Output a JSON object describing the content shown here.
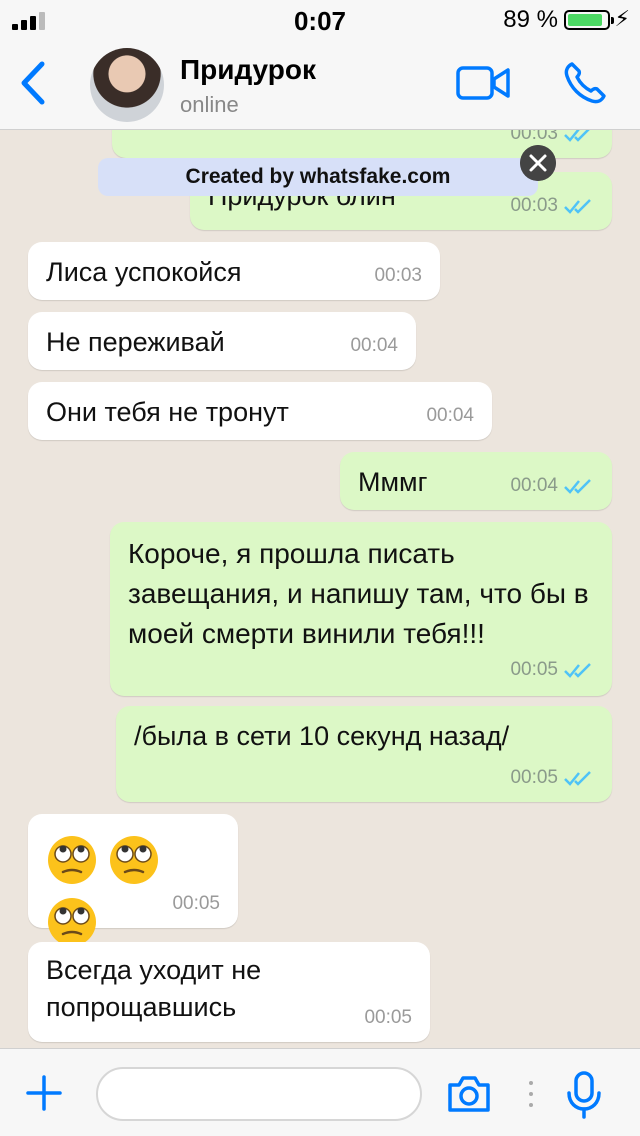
{
  "status_bar": {
    "time": "0:07",
    "battery_pct": "89 %"
  },
  "header": {
    "contact_name": "Придурок",
    "contact_status": "online"
  },
  "watermark": {
    "text": "Created by whatsfake.com"
  },
  "messages": [
    {
      "dir": "out",
      "text": "",
      "time": "00:03",
      "ticks": true
    },
    {
      "dir": "out",
      "text": "Придурок блин",
      "time": "00:03",
      "ticks": true
    },
    {
      "dir": "in",
      "text": "Лиса успокойся",
      "time": "00:03"
    },
    {
      "dir": "in",
      "text": "Не переживай",
      "time": "00:04"
    },
    {
      "dir": "in",
      "text": "Они тебя не тронут",
      "time": "00:04"
    },
    {
      "dir": "out",
      "text": "Мммг",
      "time": "00:04",
      "ticks": true
    },
    {
      "dir": "out",
      "text": "Короче, я прошла писать завещания, и напишу там, что бы в моей смерти винили тебя!!!",
      "time": "00:05",
      "ticks": true
    },
    {
      "dir": "out",
      "text": "/была в сети 10 секунд назад/",
      "time": "00:05",
      "ticks": true
    },
    {
      "dir": "in",
      "text": "🙄 🙄 🙄",
      "time": "00:05",
      "emoji": "face-with-rolling-eyes"
    },
    {
      "dir": "in",
      "text": "Всегда уходит не попрощавшись",
      "time": "00:05"
    }
  ],
  "input": {
    "placeholder": ""
  },
  "colors": {
    "accent": "#007aff",
    "outgoing": "#dcf8c6",
    "incoming": "#ffffff",
    "tick": "#4fc3f7",
    "background": "#ece5dd"
  },
  "icons": [
    "back-icon",
    "video-call-icon",
    "phone-icon",
    "plus-icon",
    "camera-icon",
    "microphone-icon",
    "double-check-icon",
    "close-icon"
  ]
}
